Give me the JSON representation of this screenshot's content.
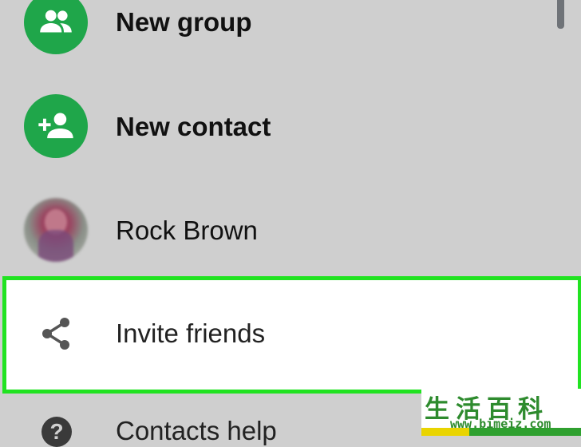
{
  "menu": {
    "items": [
      {
        "label": "New group",
        "icon": "group-icon",
        "icon_color": "#1fa64a"
      },
      {
        "label": "New contact",
        "icon": "add-person-icon",
        "icon_color": "#1fa64a"
      },
      {
        "label": "Rock Brown",
        "icon": "contact-photo"
      },
      {
        "label": "Invite friends",
        "icon": "share-icon",
        "highlighted": true
      },
      {
        "label": "Contacts help",
        "icon": "help-icon",
        "icon_glyph": "?"
      }
    ]
  },
  "highlight_color": "#21e321",
  "watermark": {
    "text_cn": "生活百科",
    "url": "www.bimeiz.com"
  }
}
